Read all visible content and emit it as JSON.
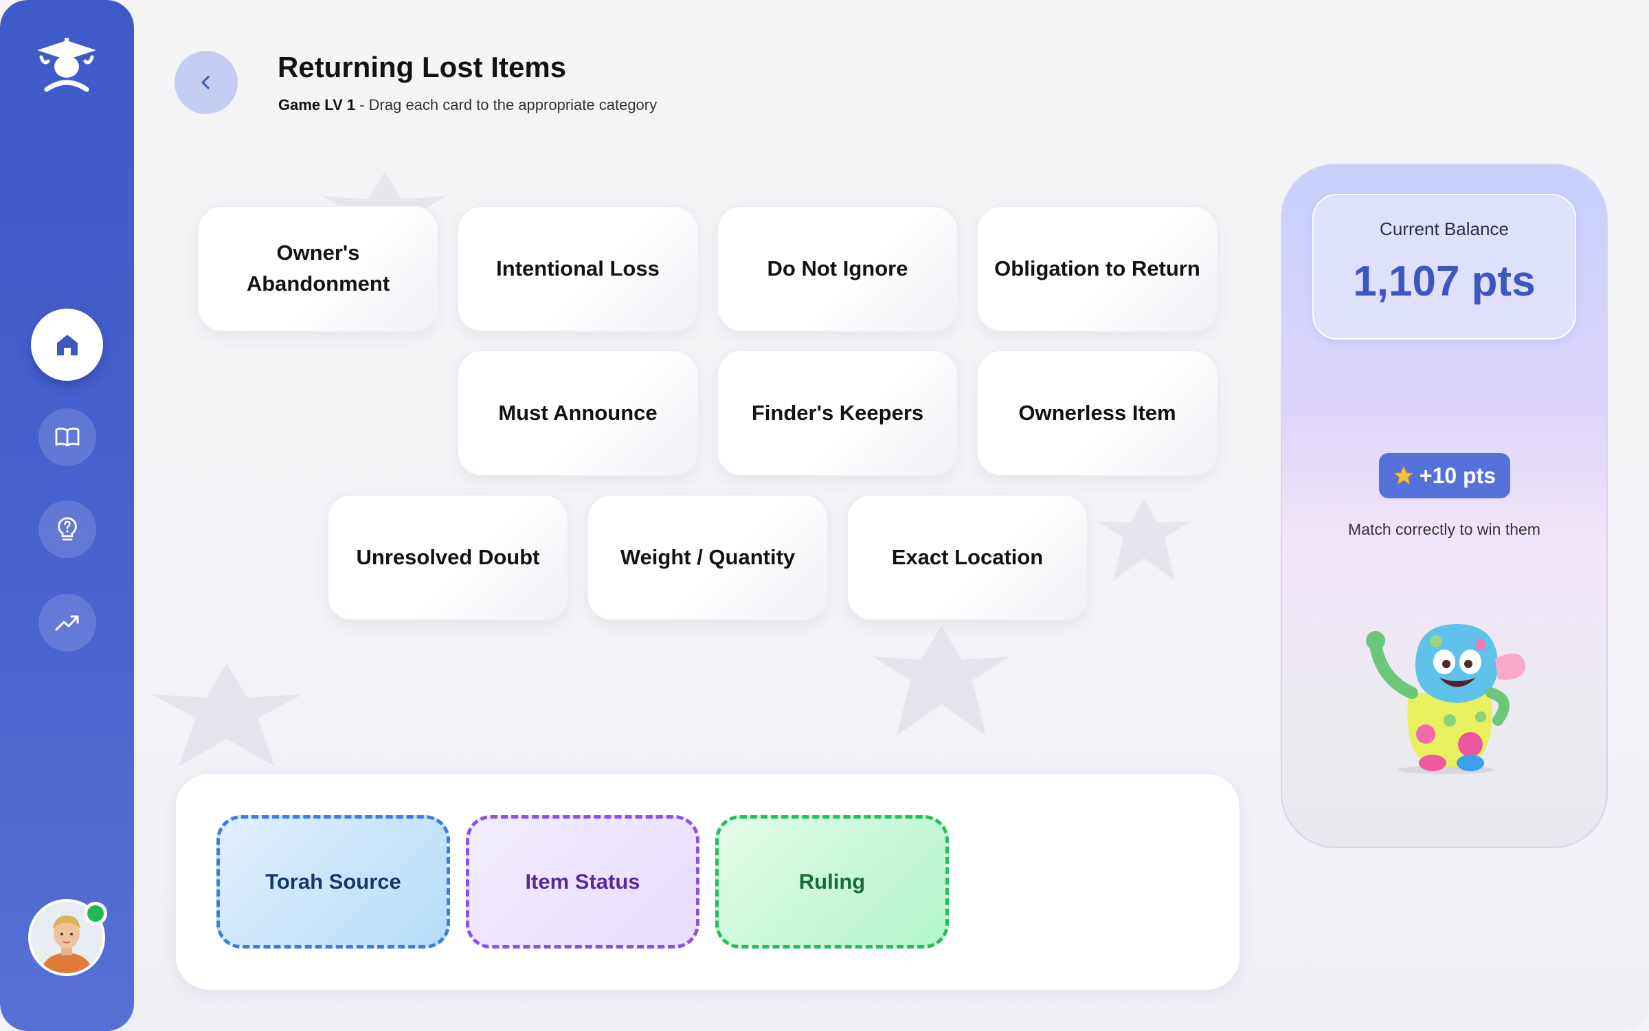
{
  "header": {
    "title": "Returning Lost Items",
    "level": "Game LV 1",
    "instruction": " - Drag each card to the appropriate category"
  },
  "sidebar": {
    "items": [
      {
        "name": "home",
        "icon": "home-icon",
        "active": true
      },
      {
        "name": "lessons",
        "icon": "book-icon",
        "active": false
      },
      {
        "name": "tips",
        "icon": "lightbulb-question-icon",
        "active": false
      },
      {
        "name": "progress",
        "icon": "trending-up-icon",
        "active": false
      }
    ],
    "user_status": "online"
  },
  "cards": [
    "Owner's Abandonment",
    "Intentional Loss",
    "Do Not Ignore",
    "Obligation to Return",
    "Must Announce",
    "Finder's Keepers",
    "Ownerless Item",
    "Unresolved Doubt",
    "Weight / Quantity",
    "Exact Location"
  ],
  "categories": [
    "Torah Source",
    "Item Status",
    "Ruling"
  ],
  "balance": {
    "label": "Current Balance",
    "value": "1,107 pts"
  },
  "reward": {
    "badge": "+10 pts",
    "text": "Match correctly to win them"
  },
  "colors": {
    "sidebar": "#4a63cf",
    "accent": "#3e56bf",
    "torah_border": "#3a7de3",
    "status_border": "#8a52e0",
    "ruling_border": "#22c05b",
    "online": "#1db954"
  }
}
